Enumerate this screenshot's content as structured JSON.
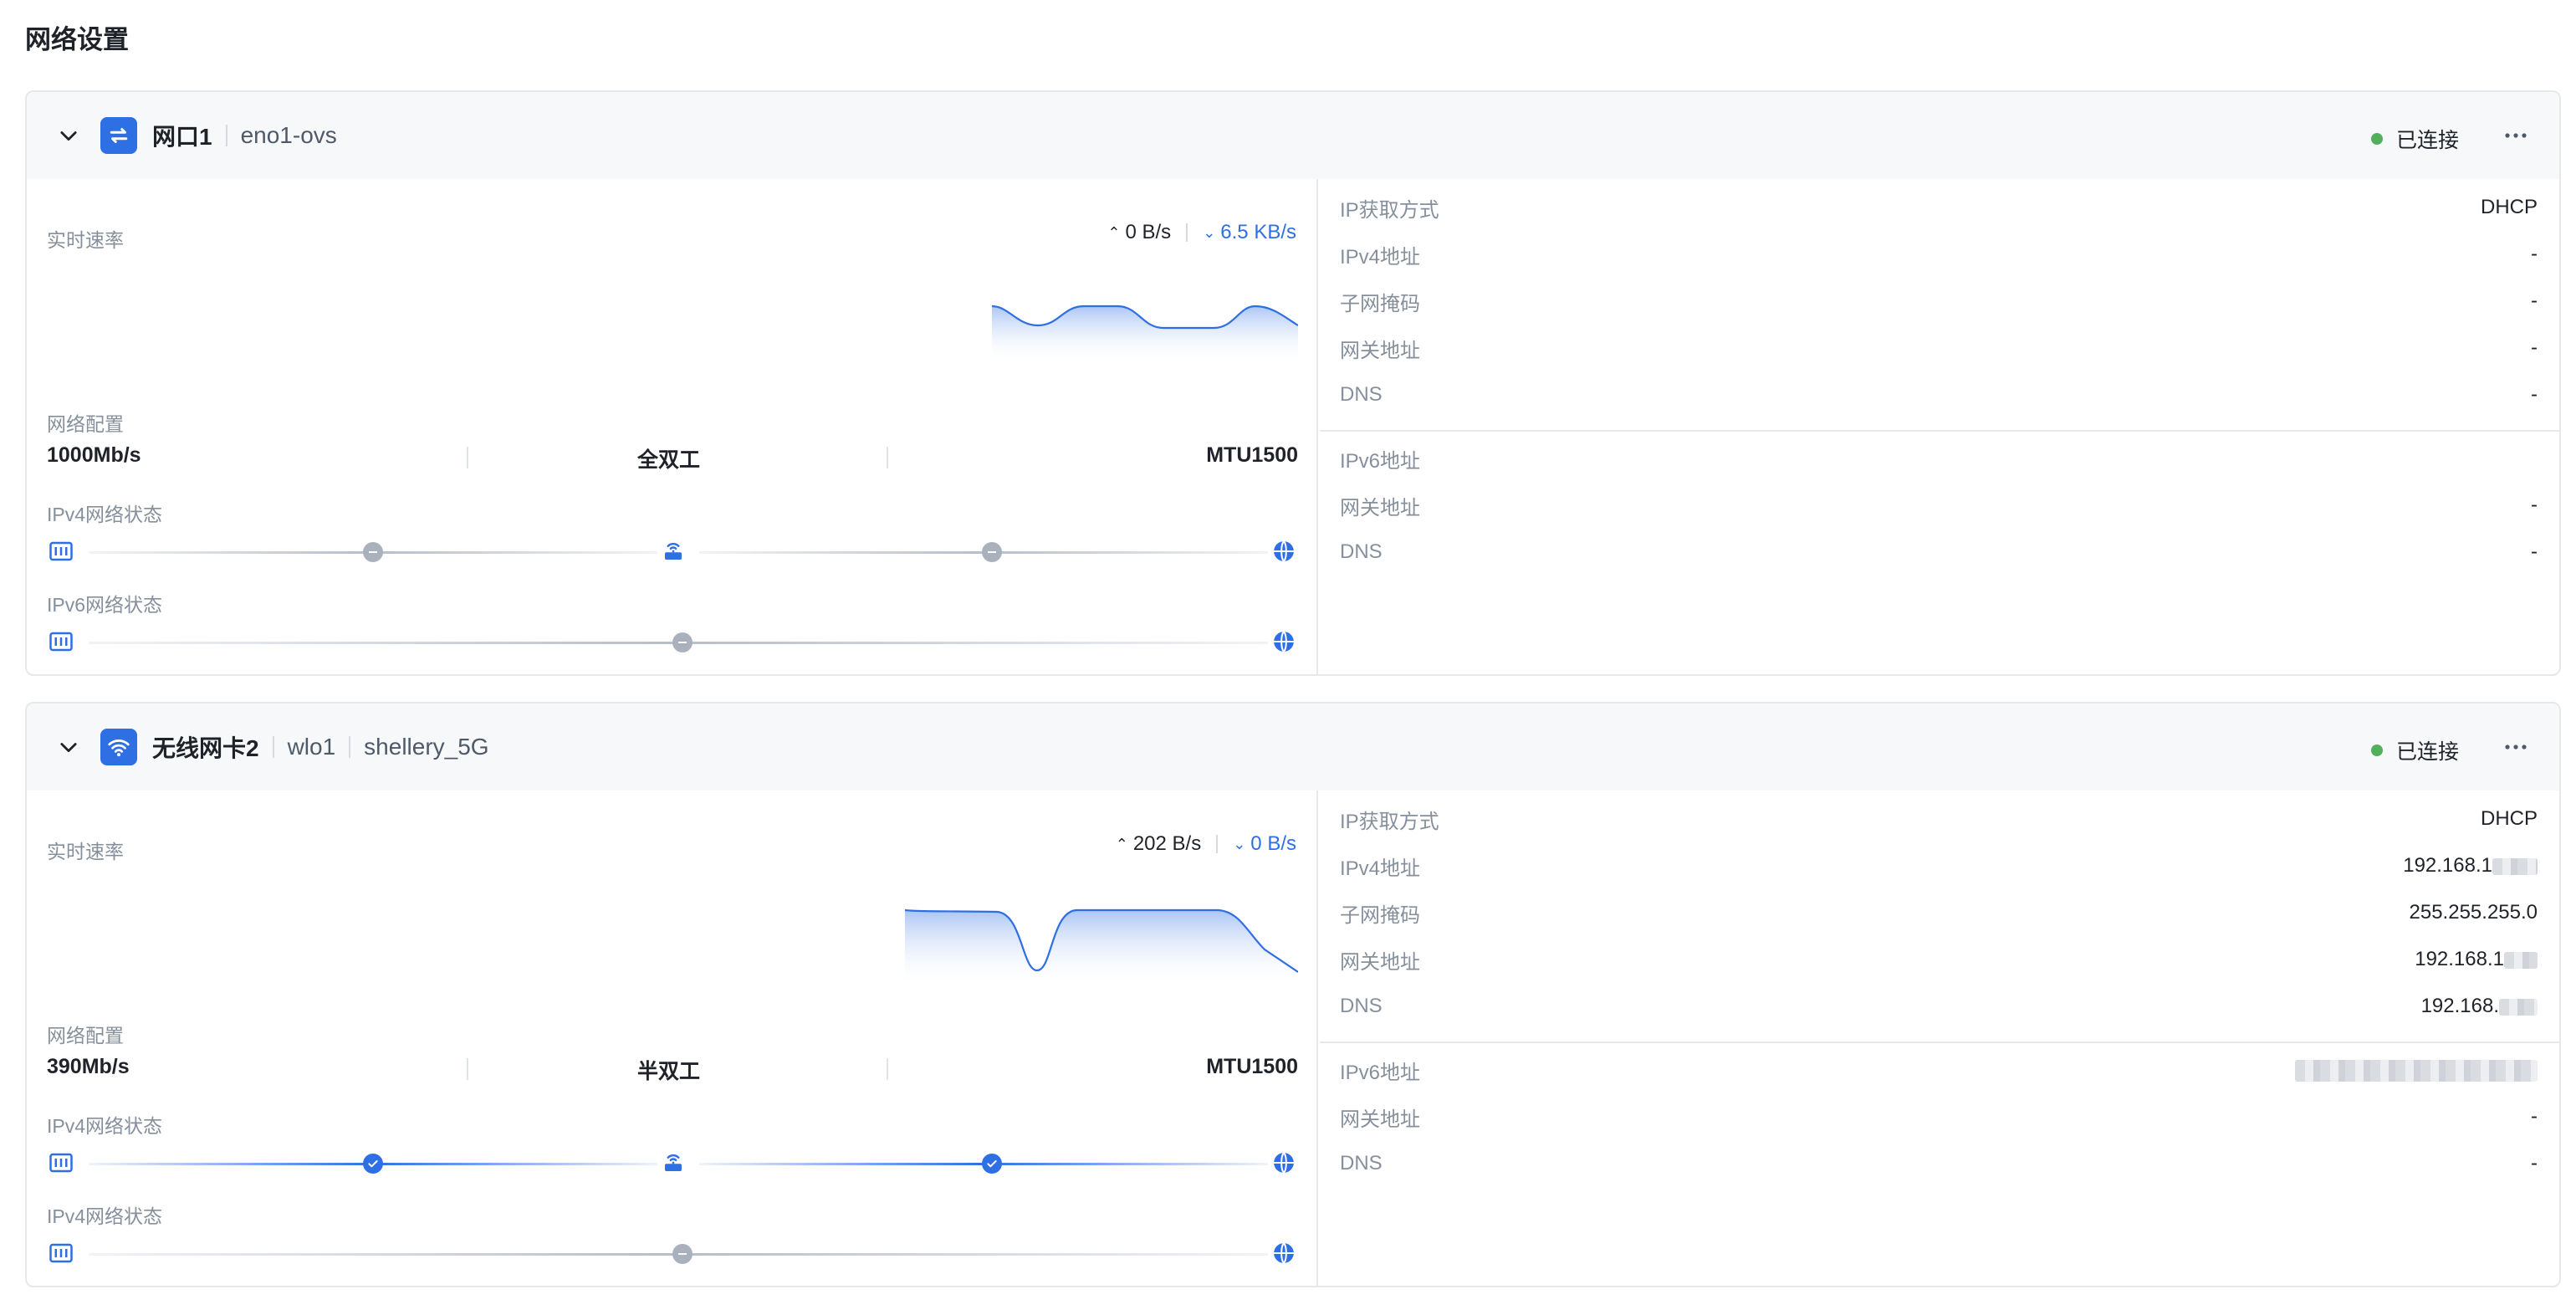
{
  "page": {
    "title": "网络设置"
  },
  "labels": {
    "rate": "实时速率",
    "netcfg": "网络配置",
    "ipv4_state": "IPv4网络状态",
    "ipv6_state": "IPv6网络状态"
  },
  "colors": {
    "accent": "#2f6fe4",
    "connected": "#52b05c",
    "idle": "#a9b1bd"
  },
  "cards": [
    {
      "name": "网口1",
      "sub1": "eno1-ovs",
      "sub2": "",
      "icon": "ethernet-swap-icon",
      "status": "已连接",
      "up_rate": "0 B/s",
      "down_rate": "6.5 KB/s",
      "speed": "1000Mb/s",
      "duplex": "全双工",
      "mtu": "MTU1500",
      "ipv4_state": "idle",
      "ipv6_state": "idle",
      "ipv4": [
        {
          "k": "IP获取方式",
          "v": "DHCP"
        },
        {
          "k": "IPv4地址",
          "v": "-"
        },
        {
          "k": "子网掩码",
          "v": "-"
        },
        {
          "k": "网关地址",
          "v": "-"
        },
        {
          "k": "DNS",
          "v": "-"
        }
      ],
      "ipv6": [
        {
          "k": "IPv6地址",
          "v": ""
        },
        {
          "k": "网关地址",
          "v": "-"
        },
        {
          "k": "DNS",
          "v": "-"
        }
      ]
    },
    {
      "name": "无线网卡2",
      "sub1": "wlo1",
      "sub2": "shellery_5G",
      "icon": "wifi-icon",
      "status": "已连接",
      "up_rate": "202 B/s",
      "down_rate": "0 B/s",
      "speed": "390Mb/s",
      "duplex": "半双工",
      "mtu": "MTU1500",
      "ipv4_state": "connected",
      "ipv6_state": "idle",
      "ipv4": [
        {
          "k": "IP获取方式",
          "v": "DHCP"
        },
        {
          "k": "IPv4地址",
          "v": "192.168.1"
        },
        {
          "k": "子网掩码",
          "v": "255.255.255.0"
        },
        {
          "k": "网关地址",
          "v": "192.168.1"
        },
        {
          "k": "DNS",
          "v": "192.168."
        }
      ],
      "ipv6": [
        {
          "k": "IPv6地址",
          "v": ""
        },
        {
          "k": "网关地址",
          "v": "-"
        },
        {
          "k": "DNS",
          "v": "-"
        }
      ]
    }
  ]
}
